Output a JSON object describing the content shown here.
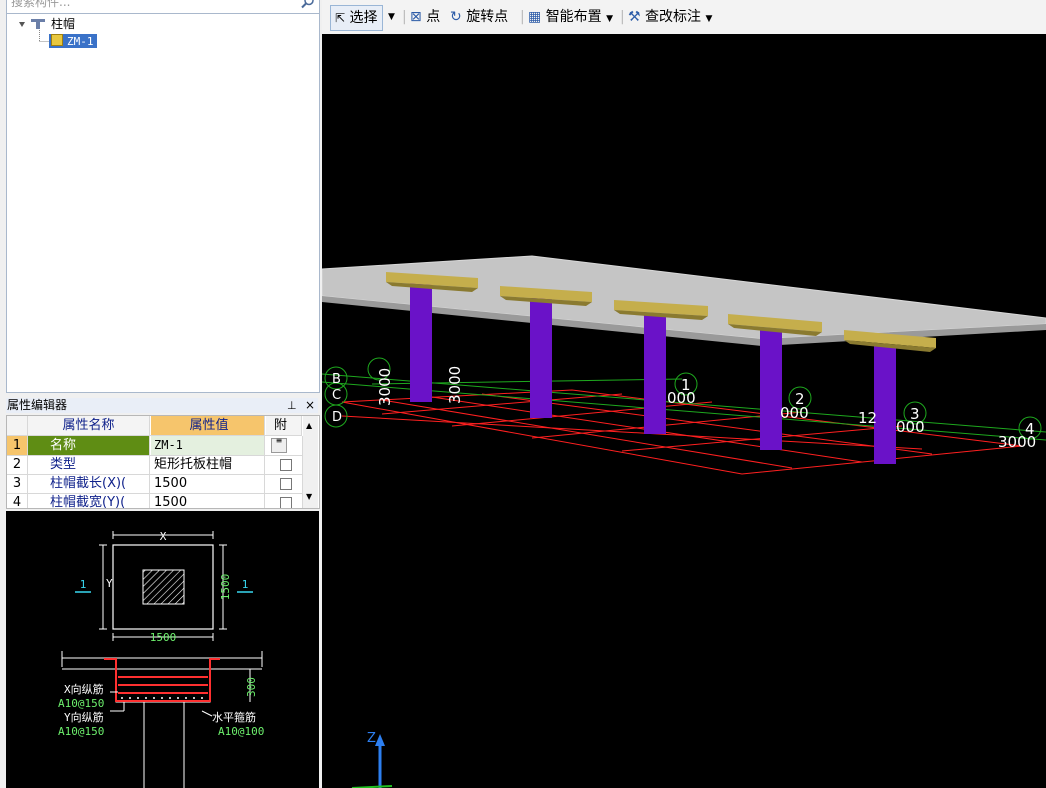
{
  "search": {
    "placeholder": "搜索构件..."
  },
  "tree": {
    "root_label": "柱帽",
    "child_label": "ZM-1"
  },
  "property_editor": {
    "title": "属性编辑器",
    "pin": "ᵖ",
    "close": "×",
    "columns": {
      "name": "属性名称",
      "value": "属性值",
      "attach": "附"
    },
    "rows": [
      {
        "idx": "1",
        "name": "名称",
        "value": "ZM-1"
      },
      {
        "idx": "2",
        "name": "类型",
        "value": "矩形托板柱帽"
      },
      {
        "idx": "3",
        "name": "柱帽截长(X)(",
        "value": "1500"
      },
      {
        "idx": "4",
        "name": "柱帽截宽(Y)(",
        "value": "1500"
      }
    ]
  },
  "preview": {
    "x_label": "X",
    "y_label": "Y",
    "section_mark": "1",
    "dim_x": "1500",
    "dim_y": "1500",
    "height_dim": "300",
    "x_rebar_label": "X向纵筋",
    "x_rebar_spec": "A10@150",
    "y_rebar_label": "Y向纵筋",
    "y_rebar_spec": "A10@150",
    "stirrup_label": "水平箍筋",
    "stirrup_spec": "A10@100"
  },
  "toolbar": {
    "select": "选择",
    "point": "点",
    "rotate_point": "旋转点",
    "smart_layout": "智能布置",
    "check_mark": "查改标注"
  },
  "viewport": {
    "axis_z": "Z",
    "grid_numbers": [
      "1",
      "2",
      "3",
      "4"
    ],
    "grid_letters": [
      "B",
      "C",
      "D"
    ],
    "dims": [
      "3000",
      "3000",
      "000",
      "000",
      "12",
      "000",
      "3000"
    ]
  },
  "colors": {
    "slab": "#c5c5c5",
    "cap": "#c5ae4c",
    "column": "#6a12c8",
    "grid_red": "#ff2020",
    "grid_green": "#1ea81e",
    "selected": "#3a72c8"
  }
}
